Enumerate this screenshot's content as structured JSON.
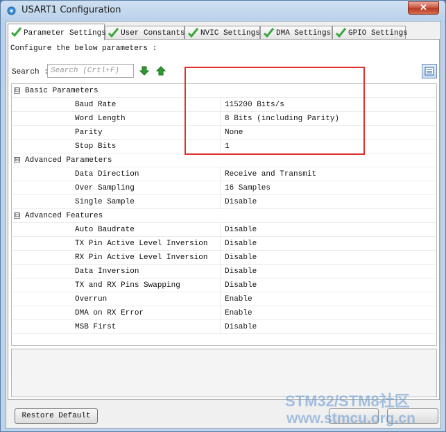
{
  "window": {
    "title": "USART1 Configuration",
    "close_label": "✕"
  },
  "tabs": [
    {
      "label": "Parameter Settings",
      "active": true
    },
    {
      "label": "User Constants",
      "active": false
    },
    {
      "label": "NVIC Settings",
      "active": false
    },
    {
      "label": "DMA Settings",
      "active": false
    },
    {
      "label": "GPIO Settings",
      "active": false
    }
  ],
  "panel": {
    "instruction": "Configure the below parameters :",
    "search_label": "Search :",
    "search_placeholder": "Search (Crtl+F)",
    "search_value": ""
  },
  "icons": {
    "tab_status": "check-icon",
    "search_next": "arrow-down-icon",
    "search_prev": "arrow-up-icon",
    "view_toggle": "list-view-icon",
    "group_toggle": "collapse-icon",
    "title_icon": "app-gear-icon"
  },
  "groups": [
    {
      "label": "Basic Parameters",
      "toggle": "⊟",
      "params": [
        {
          "name": "Baud Rate",
          "value": "115200 Bits/s"
        },
        {
          "name": "Word Length",
          "value": "8 Bits (including Parity)"
        },
        {
          "name": "Parity",
          "value": "None"
        },
        {
          "name": "Stop Bits",
          "value": "1"
        }
      ]
    },
    {
      "label": "Advanced Parameters",
      "toggle": "⊟",
      "params": [
        {
          "name": "Data Direction",
          "value": "Receive and Transmit"
        },
        {
          "name": "Over Sampling",
          "value": "16 Samples"
        },
        {
          "name": "Single Sample",
          "value": "Disable"
        }
      ]
    },
    {
      "label": "Advanced Features",
      "toggle": "⊟",
      "params": [
        {
          "name": "Auto Baudrate",
          "value": "Disable"
        },
        {
          "name": "TX Pin Active Level Inversion",
          "value": "Disable"
        },
        {
          "name": "RX Pin Active Level Inversion",
          "value": "Disable"
        },
        {
          "name": "Data Inversion",
          "value": "Disable"
        },
        {
          "name": "TX and RX Pins Swapping",
          "value": "Disable"
        },
        {
          "name": "Overrun",
          "value": "Enable"
        },
        {
          "name": "DMA on RX Error",
          "value": "Enable"
        },
        {
          "name": "MSB First",
          "value": "Disable"
        }
      ]
    }
  ],
  "footer": {
    "restore_label": "Restore Default"
  },
  "watermark": {
    "line1": "STM32/STM8社区",
    "line2": "www.stmcu.org.cn"
  },
  "colors": {
    "highlight": "#e03030",
    "check_green": "#3aa63a",
    "arrow_green": "#2f9a2f"
  }
}
